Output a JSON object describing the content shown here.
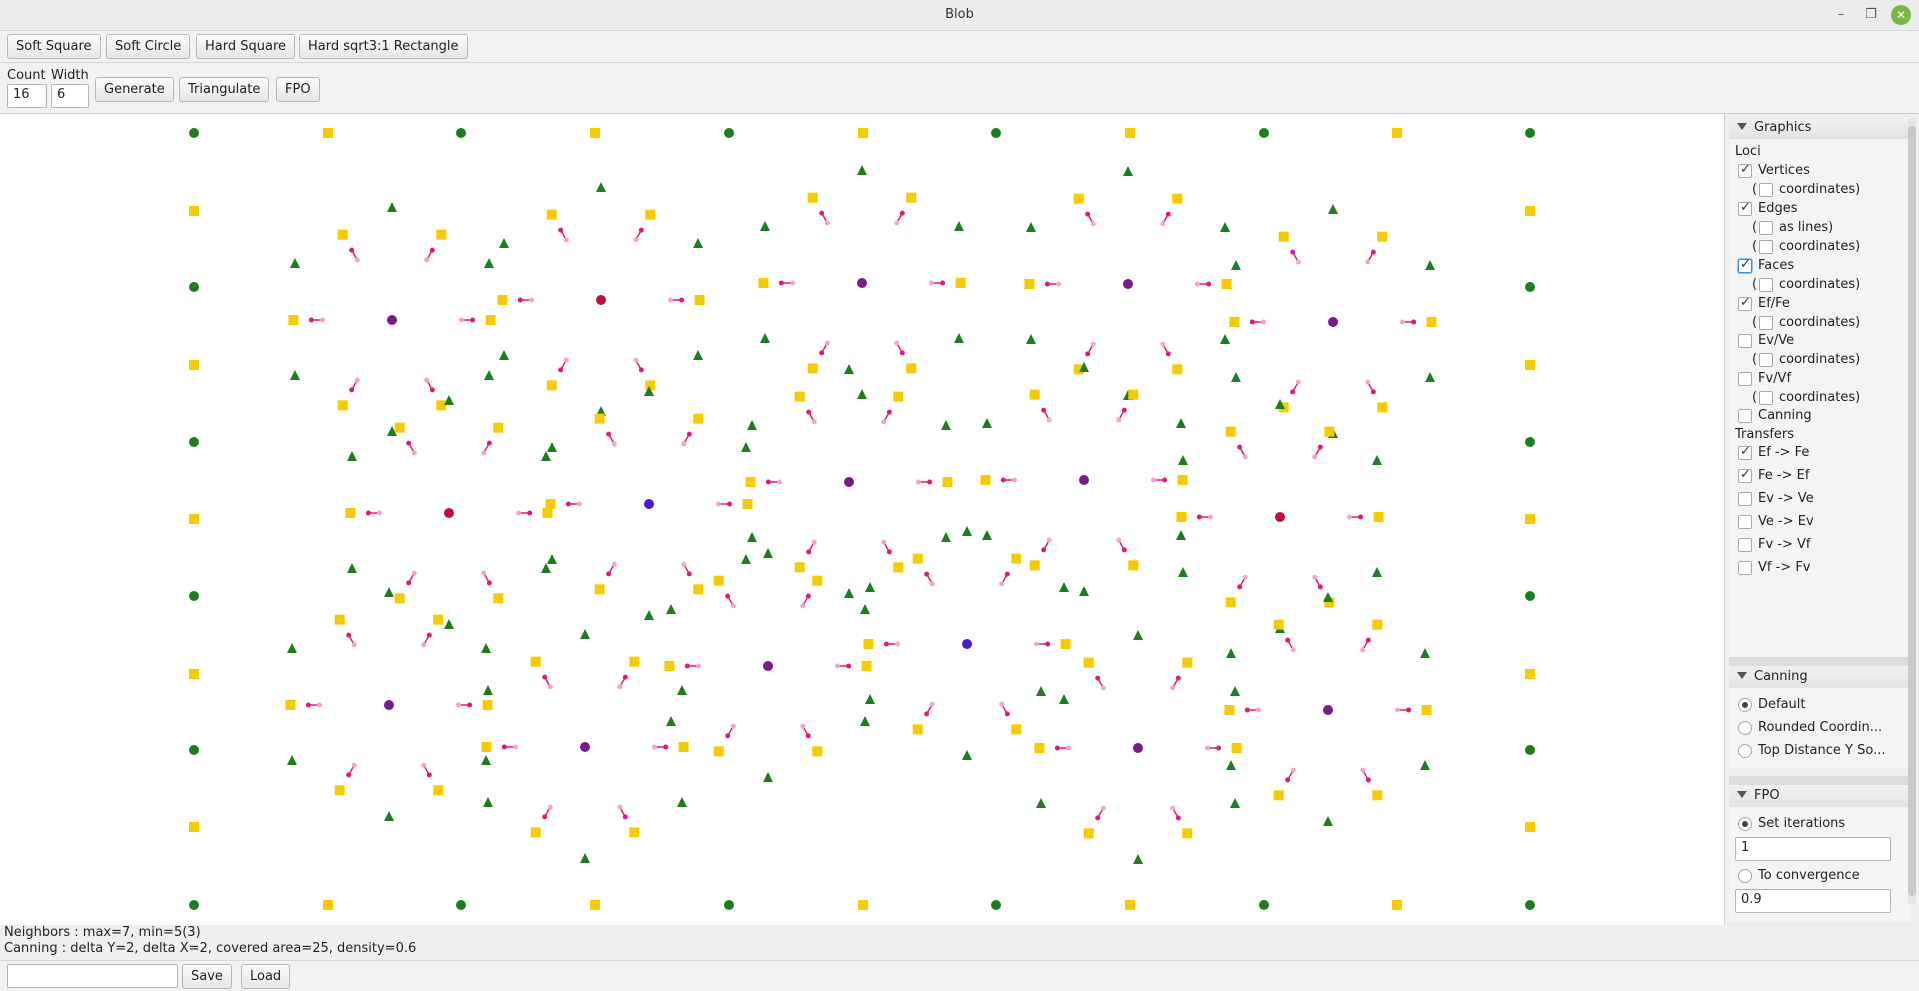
{
  "window": {
    "title": "Blob",
    "minimize_glyph": "–",
    "restore_glyph": "❐",
    "close_glyph": "✕"
  },
  "toolbar1": {
    "soft_square": "Soft Square",
    "soft_circle": "Soft Circle",
    "hard_square": "Hard Square",
    "hard_rect": "Hard sqrt3:1 Rectangle"
  },
  "toolbar2": {
    "count_label": "Count",
    "width_label": "Width",
    "count_value": "16",
    "width_value": "6",
    "generate": "Generate",
    "triangulate": "Triangulate",
    "fpo": "FPO"
  },
  "graphics": {
    "header": "Graphics",
    "loci_label": "Loci",
    "vertices": "Vertices",
    "vertices_coords": "coordinates)",
    "edges": "Edges",
    "edges_lines": "as lines)",
    "edges_coords": "coordinates)",
    "faces": "Faces",
    "faces_coords": "coordinates)",
    "effe": "Ef/Fe",
    "effe_coords": "coordinates)",
    "evve": "Ev/Ve",
    "evve_coords": "coordinates)",
    "fvvf": "Fv/Vf",
    "fvvf_coords": "coordinates)",
    "canning": "Canning",
    "transfers_label": "Transfers",
    "t1": "Ef -> Fe",
    "t2": "Fe -> Ef",
    "t3": "Ev -> Ve",
    "t4": "Ve -> Ev",
    "t5": "Fv -> Vf",
    "t6": "Vf -> Fv",
    "paren": "("
  },
  "canning_section": {
    "header": "Canning",
    "default": "Default",
    "rounded": "Rounded Coordin...",
    "topdist": "Top Distance Y So..."
  },
  "fpo_section": {
    "header": "FPO",
    "set_iterations": "Set iterations",
    "iterations_value": "1",
    "to_convergence": "To convergence",
    "convergence_value": "0.9"
  },
  "status": {
    "neighbors": "Neighbors : max=7, min=5(3)",
    "canning": "Canning : delta Y=2, delta X=2, covered area=25, density=0.6"
  },
  "bottom": {
    "save": "Save",
    "load": "Load",
    "input_value": ""
  },
  "colors": {
    "vertex": "#1e7d1e",
    "edge": "#f5cc00",
    "face_purple": "#7a1a8a",
    "face_red": "#c0103a",
    "face_blue": "#4a1acc",
    "transfer": "#e01a7a",
    "transfer_light": "#f5a6c8",
    "close_btn": "#7ab648"
  }
}
